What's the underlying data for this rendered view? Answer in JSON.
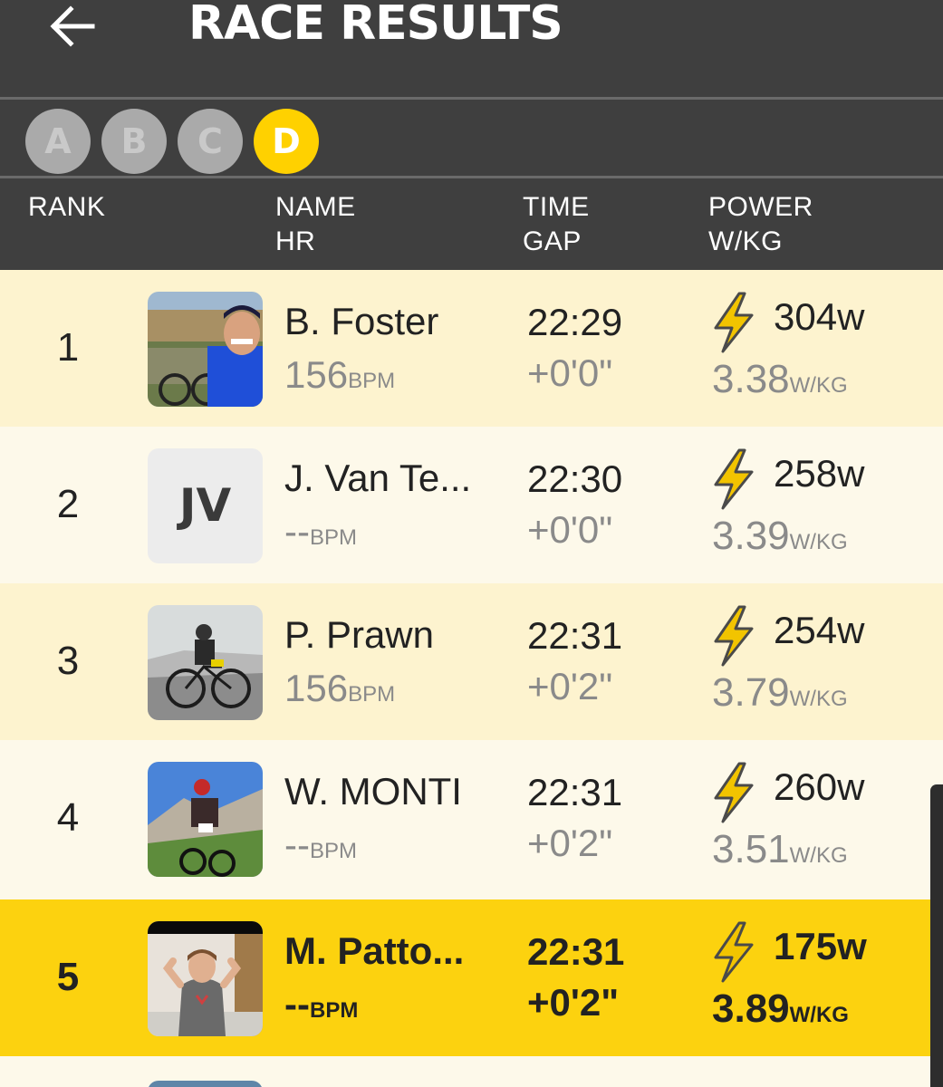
{
  "header": {
    "title": "RACE RESULTS",
    "back_icon": "arrow-left-icon"
  },
  "categories": [
    {
      "label": "A",
      "active": false
    },
    {
      "label": "B",
      "active": false
    },
    {
      "label": "C",
      "active": false
    },
    {
      "label": "D",
      "active": true
    }
  ],
  "columns": {
    "rank": "RANK",
    "name": "NAME",
    "hr": "HR",
    "time": "TIME",
    "gap": "GAP",
    "power": "POWER",
    "wkg": "W/KG"
  },
  "units": {
    "bpm": "BPM",
    "wkg": "W/KG"
  },
  "rows": [
    {
      "rank": "1",
      "name": "B. Foster",
      "hr": "156",
      "time": "22:29",
      "gap": "+0'0\"",
      "watts": "304w",
      "wkg": "3.38",
      "avatar": "photo",
      "initials": ""
    },
    {
      "rank": "2",
      "name": "J. Van Te...",
      "hr": "--",
      "time": "22:30",
      "gap": "+0'0\"",
      "watts": "258w",
      "wkg": "3.39",
      "avatar": "initials",
      "initials": "JV"
    },
    {
      "rank": "3",
      "name": "P. Prawn",
      "hr": "156",
      "time": "22:31",
      "gap": "+0'2\"",
      "watts": "254w",
      "wkg": "3.79",
      "avatar": "photo",
      "initials": ""
    },
    {
      "rank": "4",
      "name": "W. MONTI",
      "hr": "--",
      "time": "22:31",
      "gap": "+0'2\"",
      "watts": "260w",
      "wkg": "3.51",
      "avatar": "photo",
      "initials": ""
    },
    {
      "rank": "5",
      "name": "M. Patto...",
      "hr": "--",
      "time": "22:31",
      "gap": "+0'2\"",
      "watts": "175w",
      "wkg": "3.89",
      "avatar": "photo",
      "initials": ""
    }
  ],
  "colors": {
    "header_bg": "#3f3f3f",
    "accent": "#ffd100",
    "highlight_row": "#fcd20f",
    "row_light": "#fdf3cf",
    "row_lighter": "#fdf9ea"
  }
}
